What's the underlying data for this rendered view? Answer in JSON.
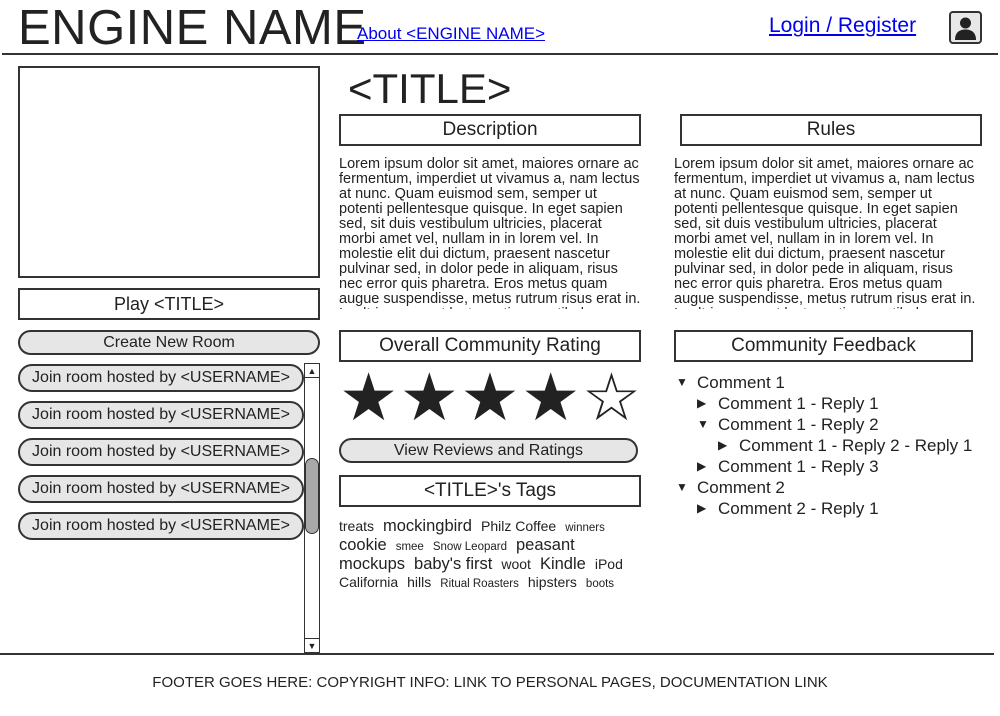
{
  "header": {
    "engine_name": "ENGINE NAME",
    "about_link": "About <ENGINE NAME>",
    "login_link": "Login / Register",
    "avatar_icon": "user-avatar-icon"
  },
  "sidebar": {
    "play_label": "Play <TITLE>",
    "create_room_label": "Create New Room",
    "rooms": [
      "Join room hosted by <USERNAME>",
      "Join room hosted by <USERNAME>",
      "Join room hosted by <USERNAME>",
      "Join room hosted by <USERNAME>",
      "Join room hosted by <USERNAME>"
    ],
    "scroll_up": "▲",
    "scroll_down": "▼"
  },
  "main": {
    "title": "<TITLE>",
    "description_header": "Description",
    "description_text": "Lorem ipsum dolor sit amet, maiores ornare ac fermentum, imperdiet ut vivamus a, nam lectus at nunc. Quam euismod sem, semper ut potenti pellentesque quisque. In eget sapien sed, sit duis vestibulum ultricies, placerat morbi amet vel, nullam in in lorem vel. In molestie elit dui dictum, praesent nascetur pulvinar sed, in dolor pede in aliquam, risus nec error quis pharetra. Eros metus quam augue suspendisse, metus rutrum risus erat in.  In ultrices quo ut lectus, etiam vestibulum urna a",
    "rules_header": "Rules",
    "rules_text": "Lorem ipsum dolor sit amet, maiores ornare ac fermentum, imperdiet ut vivamus a, nam lectus at nunc. Quam euismod sem, semper ut potenti pellentesque quisque. In eget sapien sed, sit duis vestibulum ultricies, placerat morbi amet vel, nullam in in lorem vel. In molestie elit dui dictum, praesent nascetur pulvinar sed, in dolor pede in aliquam, risus nec error quis pharetra. Eros metus quam augue suspendisse, metus rutrum risus erat in.  In ultrices quo ut lectus, etiam vestibulum urna a",
    "rating_header": "Overall Community Rating",
    "rating": {
      "value": 4,
      "max": 5,
      "filled_star": "★",
      "empty_star": "☆"
    },
    "reviews_button": "View Reviews and Ratings",
    "tags_header": "<TITLE>'s Tags",
    "tag_rows": [
      [
        {
          "text": "treats",
          "size": "m"
        },
        {
          "text": "mockingbird",
          "size": "l"
        },
        {
          "text": "Philz Coffee",
          "size": "m"
        },
        {
          "text": "winners",
          "size": "s"
        }
      ],
      [
        {
          "text": "cookie",
          "size": "l"
        },
        {
          "text": "smee",
          "size": "s"
        },
        {
          "text": "Snow Leopard",
          "size": "s"
        },
        {
          "text": "peasant",
          "size": "l"
        }
      ],
      [
        {
          "text": "mockups",
          "size": "l"
        },
        {
          "text": "baby's first",
          "size": "l"
        },
        {
          "text": "woot",
          "size": "m"
        },
        {
          "text": "Kindle",
          "size": "l"
        },
        {
          "text": "iPod",
          "size": "m"
        }
      ],
      [
        {
          "text": "California",
          "size": "m"
        },
        {
          "text": "hills",
          "size": "m"
        },
        {
          "text": "Ritual Roasters",
          "size": "s"
        },
        {
          "text": "hipsters",
          "size": "m"
        },
        {
          "text": "boots",
          "size": "s"
        }
      ]
    ],
    "feedback_header": "Community Feedback",
    "comments": [
      {
        "text": "Comment 1",
        "level": 0,
        "expanded": true
      },
      {
        "text": "Comment 1 - Reply 1",
        "level": 1,
        "expanded": false
      },
      {
        "text": "Comment 1 - Reply 2",
        "level": 1,
        "expanded": true
      },
      {
        "text": "Comment 1 - Reply 2 - Reply 1",
        "level": 2,
        "expanded": false
      },
      {
        "text": "Comment 1 - Reply 3",
        "level": 1,
        "expanded": false
      },
      {
        "text": "Comment 2",
        "level": 0,
        "expanded": true
      },
      {
        "text": "Comment 2 - Reply 1",
        "level": 1,
        "expanded": false
      }
    ]
  },
  "footer": {
    "text": "FOOTER GOES HERE: COPYRIGHT INFO: LINK TO PERSONAL PAGES, DOCUMENTATION LINK"
  }
}
